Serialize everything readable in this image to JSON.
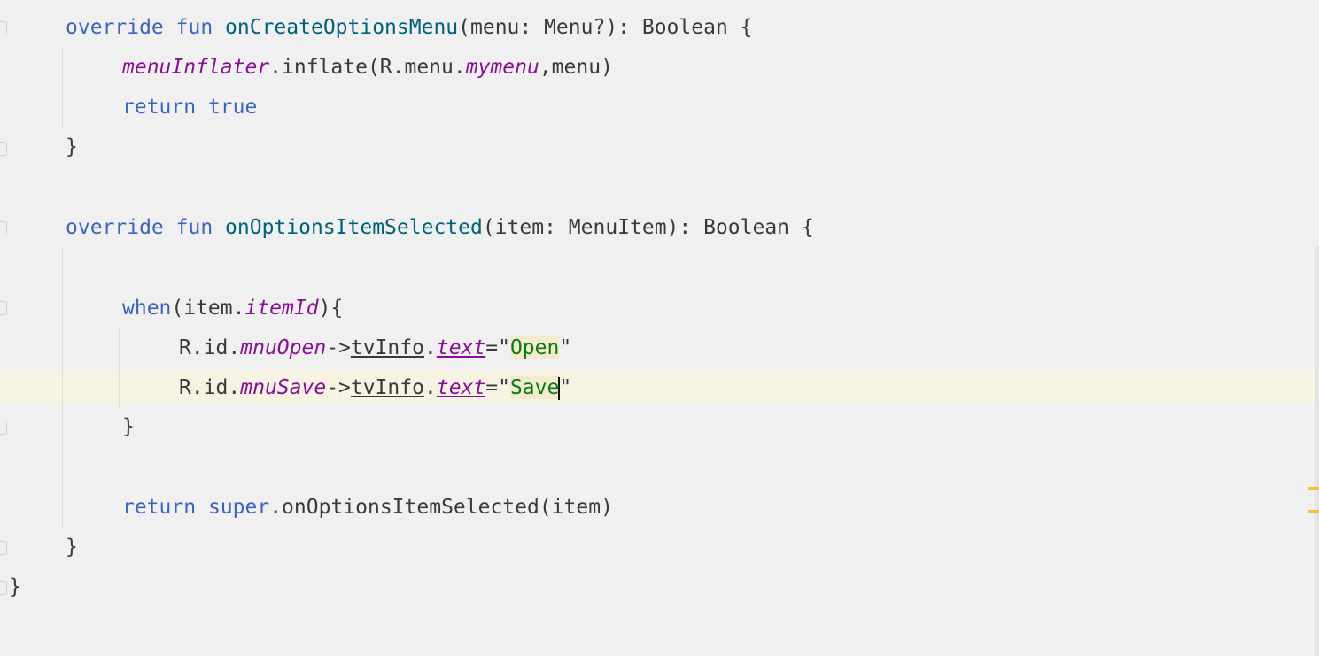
{
  "editor": {
    "language": "kotlin",
    "lines": [
      {
        "tokens": [
          {
            "text": "override",
            "style": "kw"
          },
          {
            "text": " ",
            "style": ""
          },
          {
            "text": "fun",
            "style": "kw"
          },
          {
            "text": " ",
            "style": ""
          },
          {
            "text": "onCreateOptionsMenu",
            "style": "fn"
          },
          {
            "text": "(menu: Menu?): Boolean {",
            "style": ""
          }
        ]
      },
      {
        "tokens": [
          {
            "text": "menuInflater",
            "style": "prop"
          },
          {
            "text": ".inflate(R.menu.",
            "style": ""
          },
          {
            "text": "mymenu",
            "style": "prop"
          },
          {
            "text": ",menu)",
            "style": ""
          }
        ]
      },
      {
        "tokens": [
          {
            "text": "return",
            "style": "kw"
          },
          {
            "text": " ",
            "style": ""
          },
          {
            "text": "true",
            "style": "kw"
          }
        ]
      },
      {
        "tokens": [
          {
            "text": "}",
            "style": ""
          }
        ]
      },
      {
        "tokens": [
          {
            "text": "override",
            "style": "kw"
          },
          {
            "text": " ",
            "style": ""
          },
          {
            "text": "fun",
            "style": "kw"
          },
          {
            "text": " ",
            "style": ""
          },
          {
            "text": "onOptionsItemSelected",
            "style": "fn"
          },
          {
            "text": "(item: MenuItem): Boolean {",
            "style": ""
          }
        ]
      },
      {
        "tokens": [
          {
            "text": "when",
            "style": "kw"
          },
          {
            "text": "(item.",
            "style": ""
          },
          {
            "text": "itemId",
            "style": "prop"
          },
          {
            "text": "){",
            "style": ""
          }
        ]
      },
      {
        "tokens": [
          {
            "text": "R.id.",
            "style": ""
          },
          {
            "text": "mnuOpen",
            "style": "prop"
          },
          {
            "text": "->",
            "style": ""
          },
          {
            "text": "tvInfo",
            "style": "ul"
          },
          {
            "text": ".",
            "style": ""
          },
          {
            "text": "text",
            "style": "prop ul"
          },
          {
            "text": "=\"",
            "style": ""
          },
          {
            "text": "Open",
            "style": "str occ"
          },
          {
            "text": "\"",
            "style": ""
          }
        ]
      },
      {
        "tokens": [
          {
            "text": "R.id.",
            "style": ""
          },
          {
            "text": "mnuSave",
            "style": "prop"
          },
          {
            "text": "->",
            "style": ""
          },
          {
            "text": "tvInfo",
            "style": "ul"
          },
          {
            "text": ".",
            "style": ""
          },
          {
            "text": "text",
            "style": "prop ul"
          },
          {
            "text": "=\"",
            "style": ""
          },
          {
            "text": "Save",
            "style": "str occ"
          },
          {
            "text": "|caret|",
            "style": "caret"
          },
          {
            "text": "\"",
            "style": ""
          }
        ]
      },
      {
        "tokens": [
          {
            "text": "}",
            "style": ""
          }
        ]
      },
      {
        "tokens": [
          {
            "text": "return",
            "style": "kw"
          },
          {
            "text": " ",
            "style": ""
          },
          {
            "text": "super",
            "style": "kw"
          },
          {
            "text": ".onOptionsItemSelected(item)",
            "style": ""
          }
        ]
      },
      {
        "tokens": [
          {
            "text": "}",
            "style": ""
          }
        ]
      },
      {
        "tokens": [
          {
            "text": "}",
            "style": ""
          }
        ]
      }
    ]
  }
}
